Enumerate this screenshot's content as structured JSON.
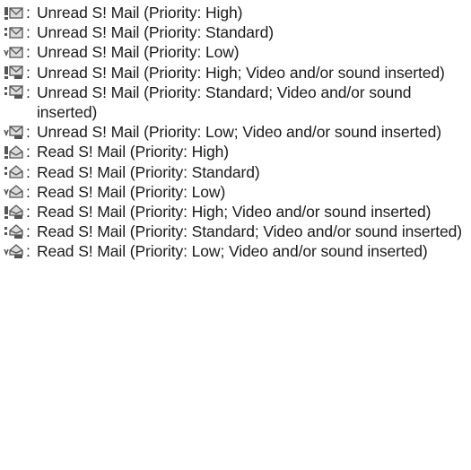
{
  "entries": [
    {
      "icon": "mail-unread-high-priority-icon",
      "colon": ":",
      "text": "Unread S! Mail (Priority: High)"
    },
    {
      "icon": "mail-unread-standard-priority-icon",
      "colon": ":",
      "text": "Unread S! Mail (Priority: Standard)"
    },
    {
      "icon": "mail-unread-low-priority-icon",
      "colon": ":",
      "text": "Unread S! Mail (Priority: Low)"
    },
    {
      "icon": "mail-unread-high-priority-media-icon",
      "colon": ":",
      "text": "Unread S! Mail (Priority: High; Video and/or sound inserted)"
    },
    {
      "icon": "mail-unread-standard-priority-media-icon",
      "colon": ":",
      "text": "Unread S! Mail (Priority: Standard; Video and/or sound inserted)"
    },
    {
      "icon": "mail-unread-low-priority-media-icon",
      "colon": ":",
      "text": "Unread S! Mail (Priority: Low; Video and/or sound inserted)"
    },
    {
      "icon": "mail-read-high-priority-icon",
      "colon": ":",
      "text": "Read S! Mail (Priority: High)"
    },
    {
      "icon": "mail-read-standard-priority-icon",
      "colon": ":",
      "text": "Read S! Mail (Priority: Standard)"
    },
    {
      "icon": "mail-read-low-priority-icon",
      "colon": ":",
      "text": "Read S! Mail (Priority: Low)"
    },
    {
      "icon": "mail-read-high-priority-media-icon",
      "colon": ":",
      "text": "Read S! Mail (Priority: High; Video and/or sound inserted)"
    },
    {
      "icon": "mail-read-standard-priority-media-icon",
      "colon": ":",
      "text": "Read S! Mail (Priority: Standard; Video and/or sound inserted)"
    },
    {
      "icon": "mail-read-low-priority-media-icon",
      "colon": ":",
      "text": "Read S! Mail (Priority: Low; Video and/or sound inserted)"
    }
  ],
  "colors": {
    "text": "#1a1a1a",
    "icon_ink": "#555555",
    "icon_fill": "#dddddd"
  }
}
